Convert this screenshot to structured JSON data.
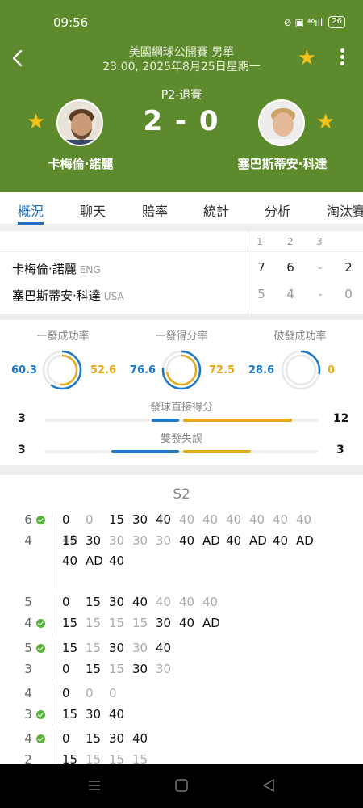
{
  "status_bar": {
    "time": "09:56",
    "icons": "⊘ ▣ ⁴⁶ıll",
    "battery": "26"
  },
  "header": {
    "competition": "美國網球公開賽 男單",
    "datetime": "23:00, 2025年8月25日星期一",
    "match_status": "P2-退賽",
    "score": "2 - 0",
    "player1": {
      "name": "卡梅倫·諾麗"
    },
    "player2": {
      "name": "塞巴斯蒂安·科達"
    },
    "accent_color": "#f4c21a",
    "bg_color": "#5d8a2c"
  },
  "tabs": [
    "概況",
    "聊天",
    "賠率",
    "統計",
    "分析",
    "淘汰賽"
  ],
  "set_table": {
    "headers": [
      "1",
      "2",
      "3"
    ],
    "rows": [
      {
        "name": "卡梅倫·諾麗",
        "country": "ENG",
        "sets": [
          "7",
          "6",
          "-"
        ],
        "total": "2"
      },
      {
        "name": "塞巴斯蒂安·科達",
        "country": "USA",
        "sets": [
          "5",
          "4",
          "-"
        ],
        "total": "0"
      }
    ]
  },
  "stats": {
    "rings": [
      {
        "title": "一發成功率",
        "p1": "60.3",
        "p2": "52.6"
      },
      {
        "title": "一發得分率",
        "p1": "76.6",
        "p2": "72.5"
      },
      {
        "title": "破發成功率",
        "p1": "28.6",
        "p2": "0"
      }
    ],
    "bars": [
      {
        "title": "發球直接得分",
        "p1": "3",
        "p2": "12"
      },
      {
        "title": "雙發失誤",
        "p1": "3",
        "p2": "3"
      }
    ]
  },
  "point_by_point": {
    "set_label": "S2",
    "games": [
      {
        "p1": "6",
        "p2": "4",
        "serve": "p1",
        "p1_points": [
          "0",
          "0",
          "15",
          "30",
          "40",
          "40",
          "40",
          "40",
          "40",
          "40",
          "40",
          "40"
        ],
        "p2_points": [
          "15",
          "30",
          "30",
          "30",
          "30",
          "40",
          "AD",
          "40",
          "AD",
          "40",
          "AD",
          "40",
          "AD",
          "40"
        ]
      },
      {
        "p1": "5",
        "p2": "4",
        "serve": "p2",
        "p1_points": [
          "0",
          "15",
          "30",
          "40",
          "40",
          "40",
          "40"
        ],
        "p2_points": [
          "15",
          "15",
          "15",
          "15",
          "30",
          "40",
          "AD"
        ]
      },
      {
        "p1": "5",
        "p2": "3",
        "serve": "p1",
        "p1_points": [
          "15",
          "15",
          "30",
          "30",
          "40"
        ],
        "p2_points": [
          "0",
          "15",
          "15",
          "30",
          "30"
        ]
      },
      {
        "p1": "4",
        "p2": "3",
        "serve": "p2",
        "p1_points": [
          "0",
          "0",
          "0"
        ],
        "p2_points": [
          "15",
          "30",
          "40"
        ]
      },
      {
        "p1": "4",
        "p2": "2",
        "serve": "p1",
        "p1_points": [
          "0",
          "15",
          "30",
          "40"
        ],
        "p2_points": [
          "15",
          "15",
          "15",
          "15"
        ]
      }
    ]
  }
}
